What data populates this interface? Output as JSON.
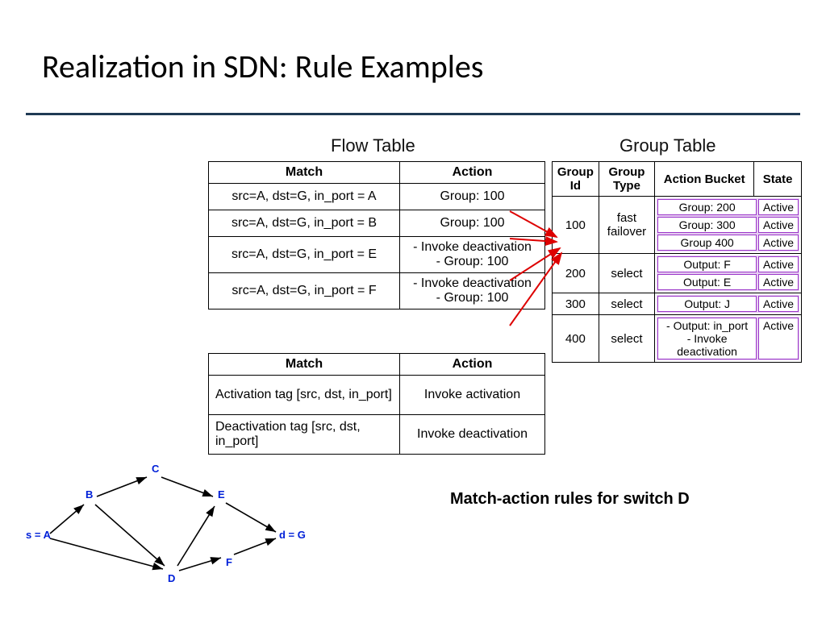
{
  "title": "Realization in SDN: Rule Examples",
  "flow_label": "Flow Table",
  "group_label": "Group Table",
  "flow_table1": {
    "headers": [
      "Match",
      "Action"
    ],
    "rows": [
      [
        "src=A, dst=G, in_port = A",
        "Group: 100"
      ],
      [
        "src=A, dst=G, in_port = B",
        "Group: 100"
      ],
      [
        "src=A, dst=G, in_port = E",
        "- Invoke deactivation\n- Group: 100"
      ],
      [
        "src=A, dst=G, in_port = F",
        "- Invoke deactivation\n- Group: 100"
      ]
    ]
  },
  "flow_table2": {
    "headers": [
      "Match",
      "Action"
    ],
    "rows": [
      [
        "Activation tag [src, dst, in_port]",
        "Invoke activation"
      ],
      [
        "Deactivation tag [src, dst, in_port]",
        "Invoke deactivation"
      ]
    ]
  },
  "group_table": {
    "headers": [
      "Group Id",
      "Group Type",
      "Action Bucket",
      "State"
    ],
    "rows": [
      {
        "id": "100",
        "type": "fast failover",
        "buckets": [
          [
            "Group: 200",
            "Active"
          ],
          [
            "Group: 300",
            "Active"
          ],
          [
            "Group 400",
            "Active"
          ]
        ]
      },
      {
        "id": "200",
        "type": "select",
        "buckets": [
          [
            "Output: F",
            "Active"
          ],
          [
            "Output: E",
            "Active"
          ]
        ]
      },
      {
        "id": "300",
        "type": "select",
        "buckets": [
          [
            "Output: J",
            "Active"
          ]
        ]
      },
      {
        "id": "400",
        "type": "select",
        "buckets": [
          [
            "- Output: in_port\n- Invoke deactivation",
            "Active"
          ]
        ]
      }
    ]
  },
  "caption": "Match-action rules for switch D",
  "graph": {
    "nodes": {
      "A": "s = A",
      "B": "B",
      "C": "C",
      "D": "D",
      "E": "E",
      "F": "F",
      "G": "d = G"
    }
  }
}
